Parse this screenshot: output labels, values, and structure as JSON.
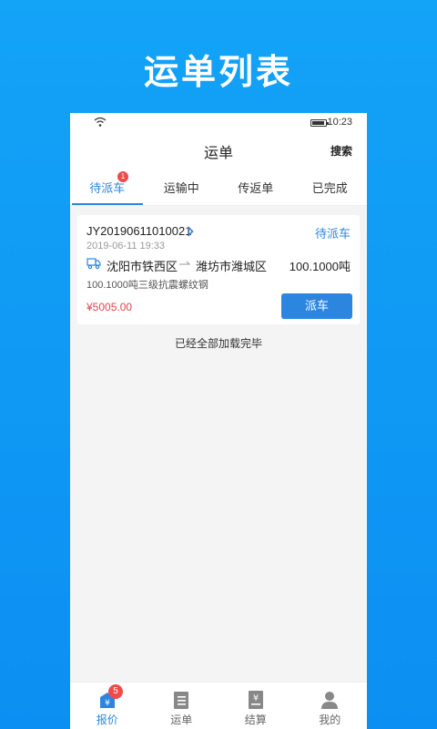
{
  "promo": {
    "title": "运单列表"
  },
  "status_bar": {
    "time": "10:23"
  },
  "navbar": {
    "title": "运单",
    "action": "搜索"
  },
  "tabs": [
    {
      "label": "待派车",
      "badge": "1",
      "active": true
    },
    {
      "label": "运输中"
    },
    {
      "label": "传返单"
    },
    {
      "label": "已完成"
    }
  ],
  "order": {
    "number": "JY20190611010021",
    "status": "待派车",
    "time": "2019-06-11 19:33",
    "from": "沈阳市铁西区",
    "to": "潍坊市潍城区",
    "weight": "100.1000吨",
    "goods": "100.1000吨三级抗震螺纹钢",
    "price": "¥5005.00",
    "action": "派车"
  },
  "list_end": "已经全部加载完毕",
  "tabbar": [
    {
      "label": "报价",
      "icon": "quote-icon",
      "badge": "5",
      "active": true
    },
    {
      "label": "运单",
      "icon": "clipboard-icon"
    },
    {
      "label": "结算",
      "icon": "settlement-icon"
    },
    {
      "label": "我的",
      "icon": "person-icon"
    }
  ],
  "colors": {
    "primary": "#2c86e0",
    "price": "#e8424b",
    "badge": "#f04b4b",
    "background": "#13a3f7"
  }
}
